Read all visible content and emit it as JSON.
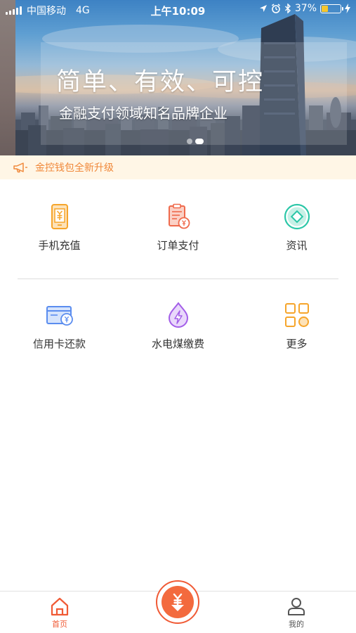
{
  "status_bar": {
    "carrier": "中国移动",
    "network": "4G",
    "time": "上午10:09",
    "battery_percent": "37%",
    "battery_level": 0.37,
    "icons": [
      "location-icon",
      "alarm-icon",
      "bluetooth-icon",
      "battery-icon",
      "charging-icon"
    ]
  },
  "banner": {
    "title": "简单、有效、可控",
    "subtitle": "金融支付领域知名品牌企业",
    "slide_count": 2,
    "active_slide": 2
  },
  "notice": {
    "text": "金控钱包全新升级",
    "icon": "megaphone-icon"
  },
  "grid": [
    {
      "label": "手机充值",
      "icon": "phone-recharge-icon",
      "color": "#f6a52b"
    },
    {
      "label": "订单支付",
      "icon": "order-payment-icon",
      "color": "#ef6a4c"
    },
    {
      "label": "资讯",
      "icon": "news-icon",
      "color": "#2cc7a8"
    },
    {
      "label": "信用卡还款",
      "icon": "credit-card-icon",
      "color": "#5b8def"
    },
    {
      "label": "水电煤缴费",
      "icon": "utility-bill-icon",
      "color": "#a35ee8"
    },
    {
      "label": "更多",
      "icon": "more-grid-icon",
      "color": "#f6a52b"
    }
  ],
  "tab_bar": {
    "home": {
      "label": "首页",
      "icon": "home-icon",
      "color": "#f05a35"
    },
    "center": {
      "icon": "yuan-download-icon",
      "color": "#f05a35"
    },
    "me": {
      "label": "我的",
      "icon": "user-icon",
      "color": "#555555"
    }
  }
}
